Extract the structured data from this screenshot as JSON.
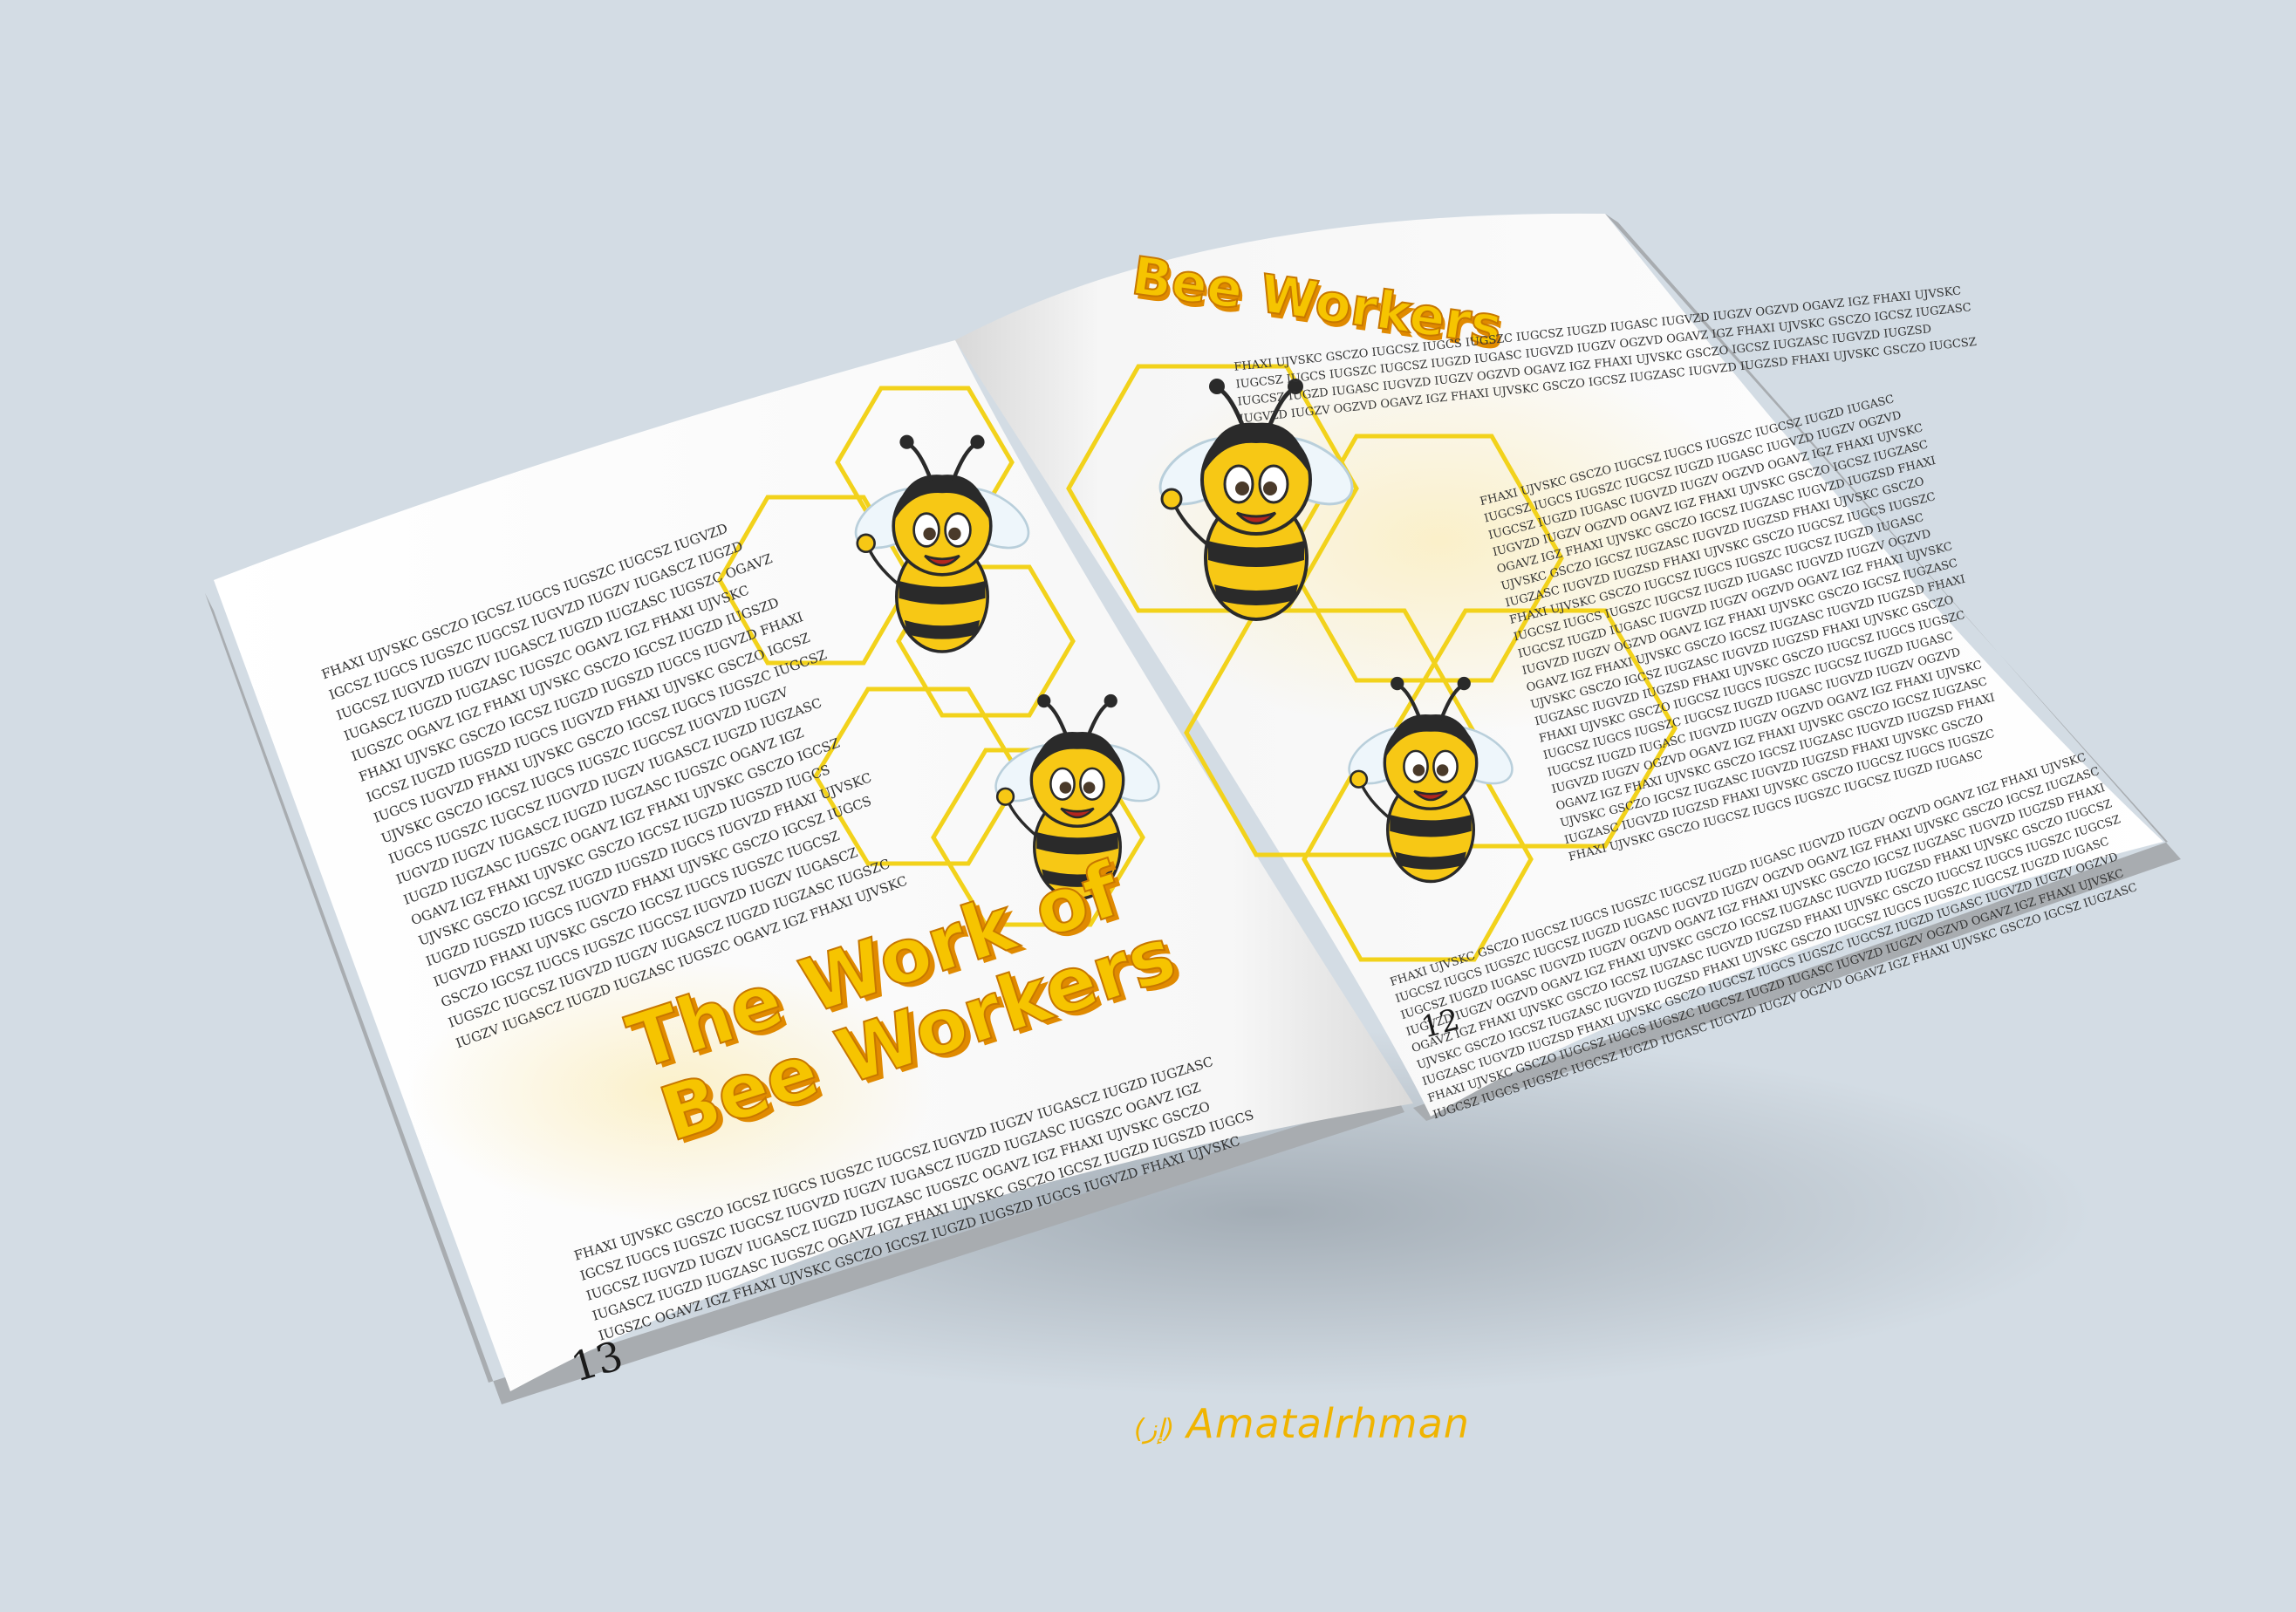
{
  "spread": {
    "left_page": {
      "title_line1": "The Work of",
      "title_line2": "Bee Workers",
      "page_number": "13",
      "filler_text": "FHAXI UJVSKC GSCZO IGCSZ IUGCS IUGSZC IUGCSZ IUGVZD IUGZV IUGASCZ IUGZD IUGZASC IUGSZC OGAVZ IGZ FHAXI UJVSKC GSCZO IGCSZ IUGZD IUGSZD IUGCS IUGVZD"
    },
    "right_page": {
      "title": "Bee Workers",
      "page_number": "12",
      "filler_text": "FHAXI UJVSKC GSCZO IUGCSZ IUGCS IUGSZC IUGCSZ IUGZD IUGASC IUGVZD IUGZV OGZVD OGAVZ IGZ FHAXI UJVSKC GSCZO IGCSZ IUGZASC IUGVZD IUGZSD"
    }
  },
  "highlight_words": [
    "IUGCSZ",
    "IUGVZD",
    "IUGZV",
    "IUGASCZ"
  ],
  "colors": {
    "background": "#d3dce4",
    "title_yellow": "#f6c400",
    "title_shadow": "#e08a00",
    "hex_stroke": "#f2d21b",
    "bee_yellow": "#f7c815",
    "bee_black": "#2a2a2a",
    "credit": "#f0b400"
  },
  "credit": {
    "signature": "(ﺇﺯ)",
    "name": "Amatalrhman"
  }
}
